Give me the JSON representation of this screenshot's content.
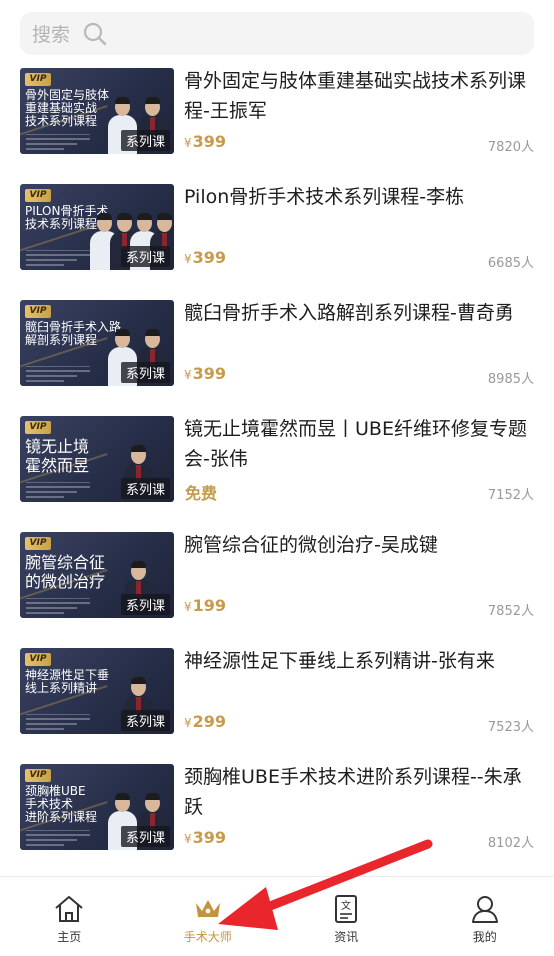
{
  "search": {
    "placeholder": "搜索"
  },
  "courses": [
    {
      "title": "骨外固定与肢体重建基础实战技术系列课程-王振军",
      "price": "399",
      "price_prefix": "¥",
      "count": "7820人",
      "badge": "系列课",
      "vip": "VIP",
      "thumb_title": "骨外固定与肢体\n重建基础实战\n技术系列课程",
      "persons": 2
    },
    {
      "title": "Pilon骨折手术技术系列课程-李栋",
      "price": "399",
      "price_prefix": "¥",
      "count": "6685人",
      "badge": "系列课",
      "vip": "VIP",
      "thumb_title": "PILON骨折手术\n技术系列课程",
      "persons": 4
    },
    {
      "title": "髋臼骨折手术入路解剖系列课程-曹奇勇",
      "price": "399",
      "price_prefix": "¥",
      "count": "8985人",
      "badge": "系列课",
      "vip": "VIP",
      "thumb_title": "髋臼骨折手术入路\n解剖系列课程",
      "persons": 2
    },
    {
      "title": "镜无止境霍然而昱丨UBE纤维环修复专题会-张伟",
      "price": "免费",
      "price_prefix": "",
      "count": "7152人",
      "badge": "系列课",
      "vip": "VIP",
      "thumb_title": "镜无止境\n霍然而昱",
      "persons": 1
    },
    {
      "title": "腕管综合征的微创治疗-吴成键",
      "price": "199",
      "price_prefix": "¥",
      "count": "7852人",
      "badge": "系列课",
      "vip": "VIP",
      "thumb_title": "腕管综合征\n的微创治疗",
      "persons": 1
    },
    {
      "title": "神经源性足下垂线上系列精讲-张有来",
      "price": "299",
      "price_prefix": "¥",
      "count": "7523人",
      "badge": "系列课",
      "vip": "VIP",
      "thumb_title": "神经源性足下垂\n线上系列精讲",
      "persons": 1
    },
    {
      "title": "颈胸椎UBE手术技术进阶系列课程--朱承跃",
      "price": "399",
      "price_prefix": "¥",
      "count": "8102人",
      "badge": "系列课",
      "vip": "VIP",
      "thumb_title": "颈胸椎UBE\n手术技术\n进阶系列课程",
      "persons": 2
    }
  ],
  "nav": {
    "home": "主页",
    "masters": "手术大师",
    "news": "资讯",
    "mine": "我的"
  },
  "colors": {
    "accent": "#c79a4c",
    "arrow": "#e8262b"
  }
}
